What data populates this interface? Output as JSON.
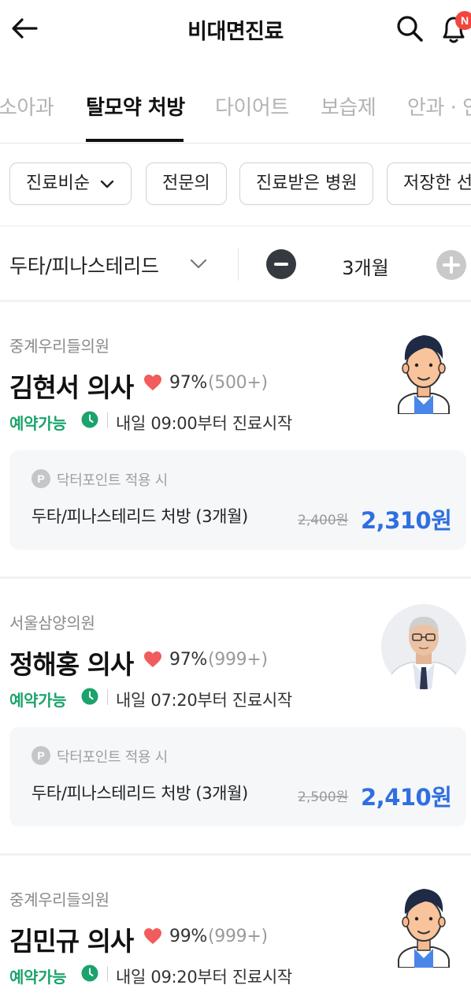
{
  "header": {
    "title": "비대면진료",
    "notification_badge": "N"
  },
  "tabs": [
    {
      "label": "소아과"
    },
    {
      "label": "탈모약 처방"
    },
    {
      "label": "다이어트"
    },
    {
      "label": "보습제"
    },
    {
      "label": "안과 · 안"
    }
  ],
  "filters": {
    "sort_label": "진료비순",
    "specialist_label": "전문의",
    "visited_label": "진료받은 병원",
    "saved_label": "저장한 선"
  },
  "selector": {
    "drug": "두타/피나스테리드",
    "duration": "3개월"
  },
  "doctors": [
    {
      "clinic": "중계우리들의원",
      "name": "김현서 의사",
      "rating": "97%",
      "rating_count": "(500+)",
      "availability": "예약가능",
      "start_time": "내일 09:00부터 진료시작",
      "point_label": "닥터포인트 적용 시",
      "prescription": "두타/피나스테리드 처방 (3개월)",
      "original_price": "2,400원",
      "sale_price": "2,310원"
    },
    {
      "clinic": "서울삼양의원",
      "name": "정해홍 의사",
      "rating": "97%",
      "rating_count": "(999+)",
      "availability": "예약가능",
      "start_time": "내일 07:20부터 진료시작",
      "point_label": "닥터포인트 적용 시",
      "prescription": "두타/피나스테리드 처방 (3개월)",
      "original_price": "2,500원",
      "sale_price": "2,410원"
    },
    {
      "clinic": "중계우리들의원",
      "name": "김민규 의사",
      "rating": "99%",
      "rating_count": "(999+)",
      "availability": "예약가능",
      "start_time": "내일 09:20부터 진료시작"
    }
  ],
  "colors": {
    "accent_green": "#1aa36b",
    "price_blue": "#2f6fe0",
    "heart_red": "#f25c5c",
    "badge_red": "#f2463d"
  }
}
